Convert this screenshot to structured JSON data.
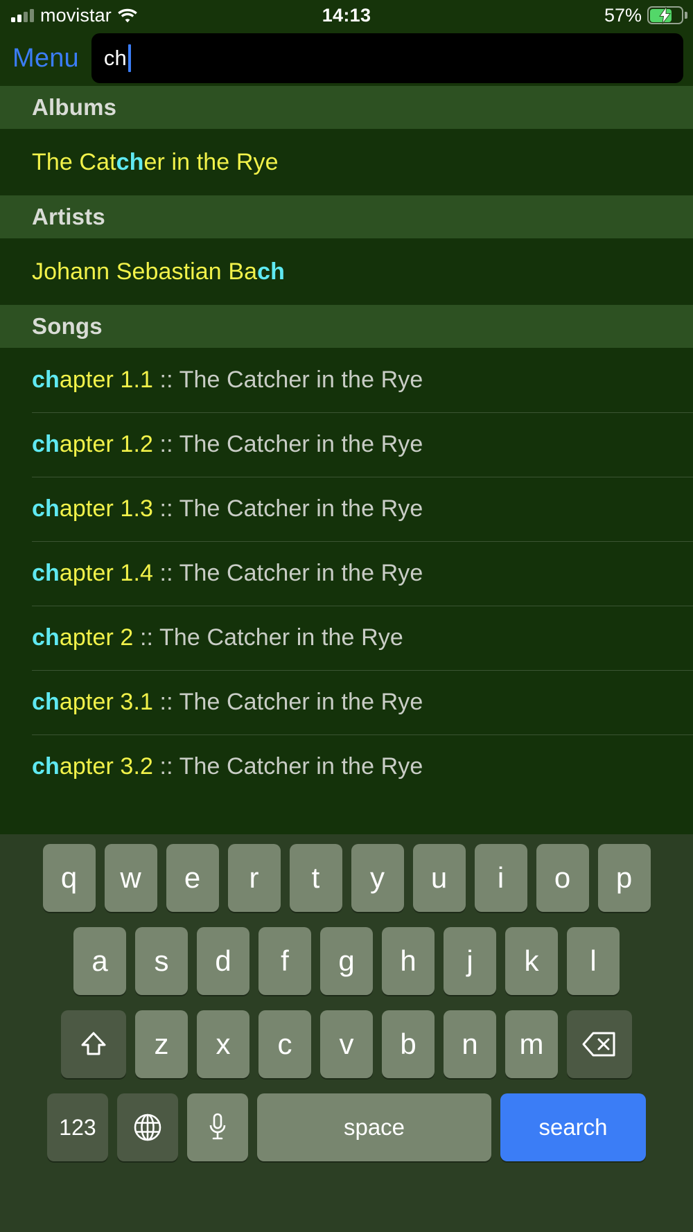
{
  "status_bar": {
    "carrier": "movistar",
    "time": "14:13",
    "battery_percent": "57%",
    "battery_level": 60,
    "charging": true,
    "signal_bars_active": 2,
    "wifi": true
  },
  "nav": {
    "menu_label": "Menu"
  },
  "search": {
    "value": "ch",
    "query": "ch"
  },
  "sections": [
    {
      "header": "Albums",
      "rows": [
        {
          "parts": [
            {
              "t": "The Cat",
              "c": "y"
            },
            {
              "t": "ch",
              "c": "m"
            },
            {
              "t": "er in the Rye",
              "c": "y"
            }
          ]
        }
      ]
    },
    {
      "header": "Artists",
      "rows": [
        {
          "parts": [
            {
              "t": "Johann Sebastian Ba",
              "c": "y"
            },
            {
              "t": "ch",
              "c": "m"
            }
          ]
        }
      ]
    },
    {
      "header": "Songs",
      "rows": [
        {
          "parts": [
            {
              "t": "ch",
              "c": "m"
            },
            {
              "t": "apter 1.1",
              "c": "y"
            },
            {
              "t": " :: The Catcher in the Rye",
              "c": "g"
            }
          ]
        },
        {
          "parts": [
            {
              "t": "ch",
              "c": "m"
            },
            {
              "t": "apter 1.2",
              "c": "y"
            },
            {
              "t": " :: The Catcher in the Rye",
              "c": "g"
            }
          ]
        },
        {
          "parts": [
            {
              "t": "ch",
              "c": "m"
            },
            {
              "t": "apter 1.3",
              "c": "y"
            },
            {
              "t": " :: The Catcher in the Rye",
              "c": "g"
            }
          ]
        },
        {
          "parts": [
            {
              "t": "ch",
              "c": "m"
            },
            {
              "t": "apter 1.4",
              "c": "y"
            },
            {
              "t": " :: The Catcher in the Rye",
              "c": "g"
            }
          ]
        },
        {
          "parts": [
            {
              "t": "ch",
              "c": "m"
            },
            {
              "t": "apter 2",
              "c": "y"
            },
            {
              "t": " :: The Catcher in the Rye",
              "c": "g"
            }
          ]
        },
        {
          "parts": [
            {
              "t": "ch",
              "c": "m"
            },
            {
              "t": "apter 3.1",
              "c": "y"
            },
            {
              "t": " :: The Catcher in the Rye",
              "c": "g"
            }
          ]
        },
        {
          "parts": [
            {
              "t": "ch",
              "c": "m"
            },
            {
              "t": "apter 3.2",
              "c": "y"
            },
            {
              "t": " :: The Catcher in the Rye",
              "c": "g"
            }
          ]
        }
      ]
    }
  ],
  "keyboard": {
    "row1": [
      "q",
      "w",
      "e",
      "r",
      "t",
      "y",
      "u",
      "i",
      "o",
      "p"
    ],
    "row2": [
      "a",
      "s",
      "d",
      "f",
      "g",
      "h",
      "j",
      "k",
      "l"
    ],
    "row3": [
      "z",
      "x",
      "c",
      "v",
      "b",
      "n",
      "m"
    ],
    "shift_icon": "shift-icon",
    "backspace_icon": "backspace-icon",
    "numbers_label": "123",
    "globe_icon": "globe-icon",
    "mic_icon": "microphone-icon",
    "space_label": "space",
    "search_label": "search"
  },
  "colors": {
    "background": "#16340a",
    "row_background": "#14320a",
    "section_header": "#2d5122",
    "match_highlight": "#5fe9f2",
    "primary_text": "#f2f24a",
    "secondary_text": "#c9cdc6",
    "accent": "#3b7df6",
    "keyboard_background": "#2c3f24",
    "key_background": "#78866f"
  }
}
